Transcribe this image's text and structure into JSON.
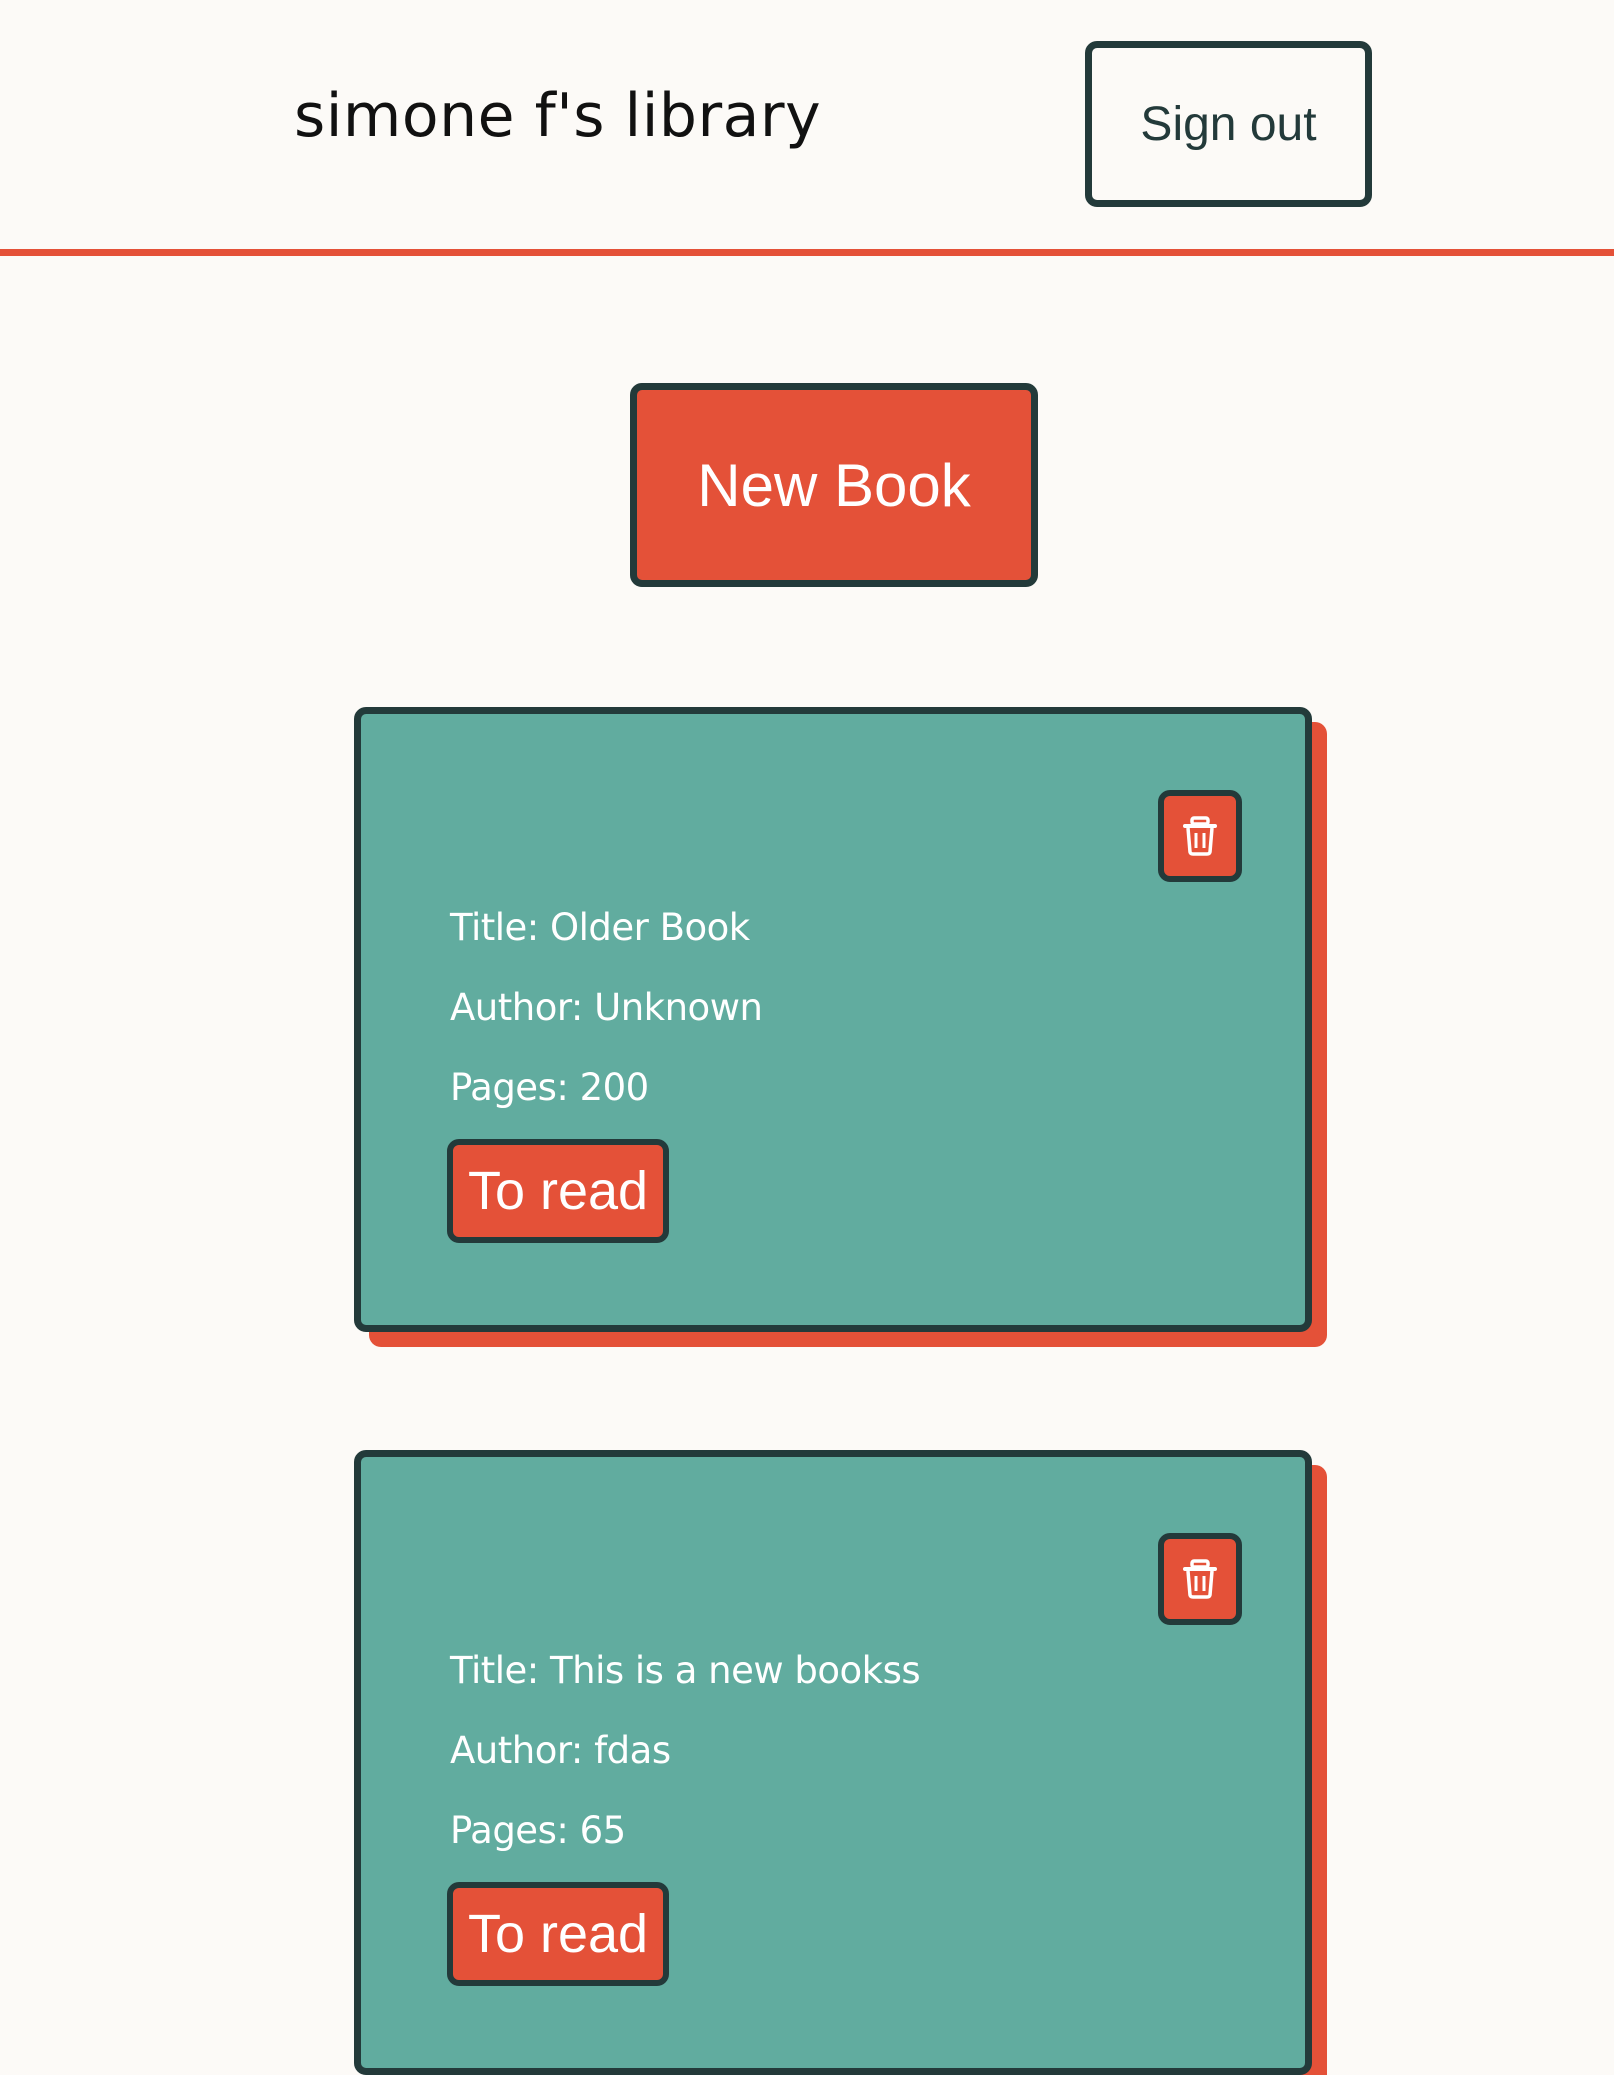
{
  "header": {
    "title": "simone f's library",
    "signout_label": "Sign out"
  },
  "main": {
    "new_book_label": "New Book"
  },
  "books": [
    {
      "title": "Title: Older Book",
      "author": "Author: Unknown",
      "pages": "Pages: 200",
      "status": "To read",
      "delete_icon": "trash-icon"
    },
    {
      "title": "Title: This is a new bookss",
      "author": "Author: fdas",
      "pages": "Pages: 65",
      "status": "To read",
      "delete_icon": "trash-icon"
    }
  ],
  "colors": {
    "accent": "#e45138",
    "card": "#61ac9f",
    "border": "#233a3a",
    "background": "#fcfaf7"
  }
}
